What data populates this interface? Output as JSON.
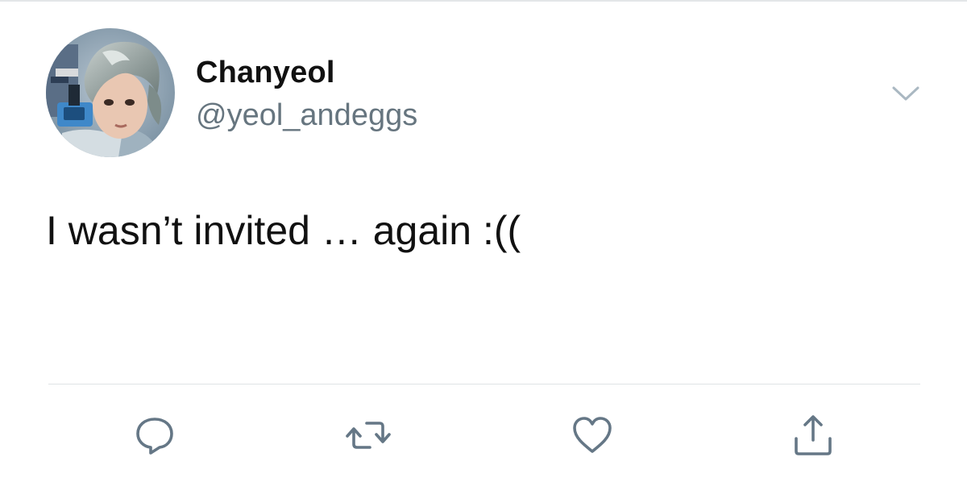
{
  "tweet": {
    "author": {
      "display_name": "Chanyeol",
      "handle": "@yeol_andeggs"
    },
    "text": "I wasn’t invited … again :(("
  },
  "actions": [
    {
      "name": "reply",
      "icon": "speech-bubble-icon"
    },
    {
      "name": "retweet",
      "icon": "retweet-arrows-icon"
    },
    {
      "name": "like",
      "icon": "heart-icon"
    },
    {
      "name": "share",
      "icon": "share-upload-icon"
    }
  ],
  "colors": {
    "text_primary": "#111111",
    "text_secondary": "#66757f",
    "icon": "#657786",
    "divider": "#dfe3e6"
  }
}
